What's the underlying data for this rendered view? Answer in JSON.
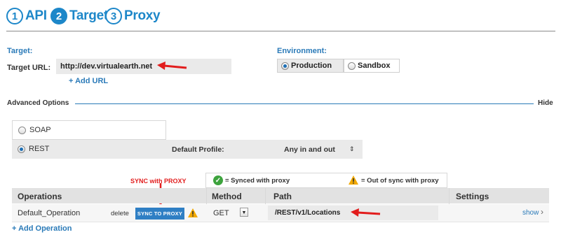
{
  "steps": [
    {
      "num": "1",
      "label": "API"
    },
    {
      "num": "2",
      "label": "Target"
    },
    {
      "num": "3",
      "label": "Proxy"
    }
  ],
  "target": {
    "section_label": "Target:",
    "url_label": "Target URL:",
    "url_value": "http://dev.virtualearth.net",
    "add_url": "+ Add URL"
  },
  "environment": {
    "label": "Environment:",
    "options": [
      "Production",
      "Sandbox"
    ],
    "selected": "Production"
  },
  "advanced": {
    "label": "Advanced Options",
    "hide": "Hide",
    "protocols": [
      "SOAP",
      "REST"
    ],
    "selected_protocol": "REST",
    "default_profile_label": "Default Profile:",
    "default_profile_value": "Any in and out"
  },
  "legend": {
    "synced": "= Synced with proxy",
    "out_of_sync": "= Out of sync with proxy"
  },
  "annotation": {
    "sync_label": "SYNC with PROXY"
  },
  "table": {
    "headers": {
      "operations": "Operations",
      "method": "Method",
      "path": "Path",
      "settings": "Settings"
    },
    "rows": [
      {
        "operation": "Default_Operation",
        "delete": "delete",
        "sync": "SYNC TO PROXY",
        "method": "GET",
        "path": "/REST/v1/Locations",
        "settings": "show"
      }
    ],
    "add_operation": "+ Add Operation"
  },
  "colors": {
    "accent": "#1d87c9",
    "annotation": "#e21d1d",
    "sync_button": "#2f7fc4"
  }
}
